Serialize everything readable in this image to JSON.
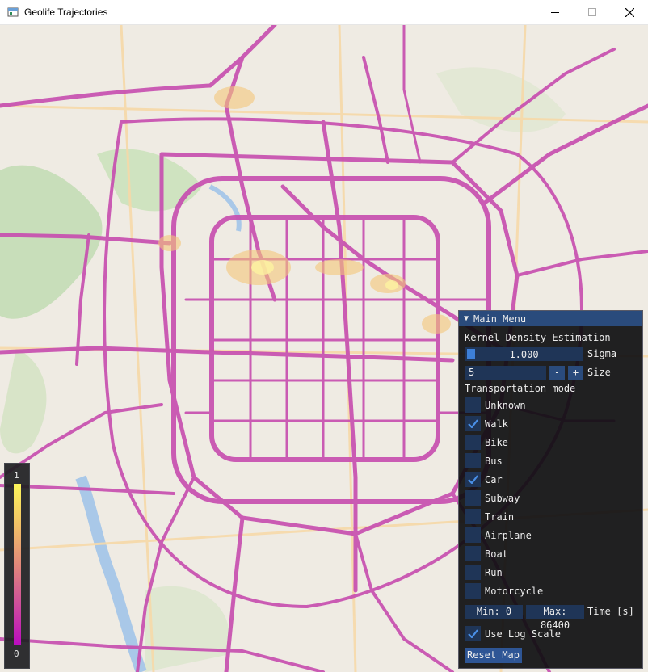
{
  "window": {
    "title": "Geolife Trajectories"
  },
  "colorbar": {
    "max_label": "1",
    "min_label": "0",
    "colors": [
      "#fcf65a",
      "#f2c266",
      "#e2887a",
      "#cd4d9c",
      "#bb0bc0"
    ]
  },
  "menu": {
    "title": "Main Menu",
    "kde_label": "Kernel Density Estimation",
    "sigma": {
      "value": "1.000",
      "label": "Sigma",
      "fraction": 0.0
    },
    "size": {
      "value": "5",
      "label": "Size",
      "minus": "-",
      "plus": "+"
    },
    "transport_label": "Transportation mode",
    "modes": [
      {
        "label": "Unknown",
        "checked": false
      },
      {
        "label": "Walk",
        "checked": true
      },
      {
        "label": "Bike",
        "checked": false
      },
      {
        "label": "Bus",
        "checked": false
      },
      {
        "label": "Car",
        "checked": true
      },
      {
        "label": "Subway",
        "checked": false
      },
      {
        "label": "Train",
        "checked": false
      },
      {
        "label": "Airplane",
        "checked": false
      },
      {
        "label": "Boat",
        "checked": false
      },
      {
        "label": "Run",
        "checked": false
      },
      {
        "label": "Motorcycle",
        "checked": false
      }
    ],
    "time": {
      "min": "Min: 0",
      "max": "Max: 86400",
      "label": "Time [s]"
    },
    "log_scale": {
      "label": "Use Log Scale",
      "checked": true
    },
    "reset_label": "Reset Map"
  },
  "colors": {
    "accent": "#2a4b7c",
    "frame": "#1f3557",
    "check": "#4a90e8",
    "route": "#c74fb0",
    "hotspot": "#f4c77a"
  }
}
